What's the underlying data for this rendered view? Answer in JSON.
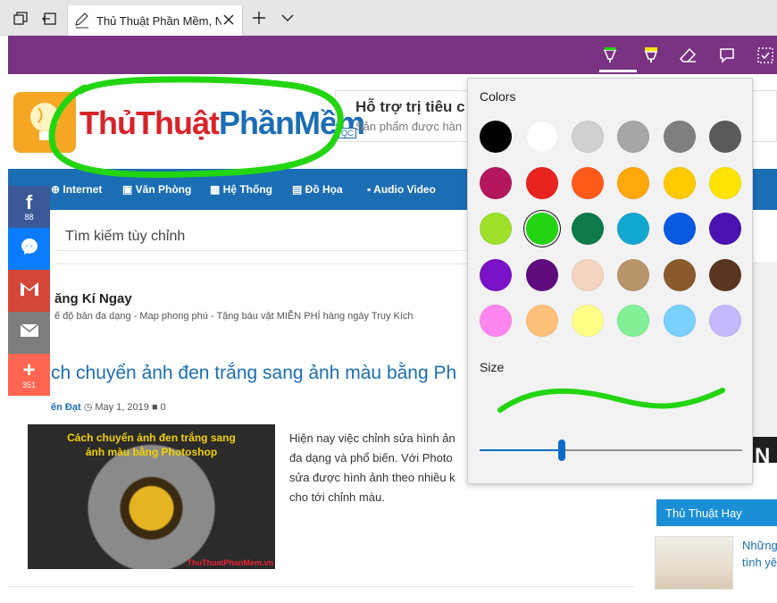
{
  "browser": {
    "tab_title": "Thủ Thuật Phần Mềm, N",
    "icons": [
      "tabs-aside-icon",
      "back-tabs-icon",
      "pen-icon",
      "close-icon",
      "plus-icon",
      "chevron-down-icon"
    ]
  },
  "ink_toolbar": {
    "tools": [
      "ballpoint-pen-icon",
      "highlighter-icon",
      "eraser-icon",
      "comment-icon",
      "clip-icon"
    ],
    "active_tool": "ballpoint-pen"
  },
  "site": {
    "logo_red": "ThủThuật",
    "logo_blue": "PhầnMềm",
    "ad_title": "Hỗ trợ trị tiêu c",
    "ad_sub": "Sản phẩm được hàn",
    "ad_badge": "QC",
    "nav": [
      "Internet",
      "Văn Phòng",
      "Hệ Thống",
      "Đồ Họa",
      "Audio Video"
    ],
    "search_text": "Tìm kiếm tùy chỉnh",
    "promo_title": "ăng Kí Ngay",
    "promo_sub": "ế độ bản đa dạng - Map phong phú - Tặng báu vật MIỄN PHÍ hàng ngày Truy Kích",
    "article_title": "ch chuyển ảnh đen trắng sang ảnh màu bằng Ph",
    "meta_author": "ến Đạt",
    "meta_date": "May 1, 2019",
    "meta_comments": "0",
    "thumb_caption_1": "Cách chuyển ảnh đen trắng sang",
    "thumb_caption_2": "ảnh màu bằng Photoshop",
    "thumb_watermark": "ThuThuatPhanMem.vn",
    "excerpt": [
      "Hiện nay việc chỉnh sửa hình ản",
      "đa dạng và phổ biến. Với Photo",
      "sửa được hình ảnh theo nhiều k",
      "cho tới chỉnh màu."
    ],
    "sidebar_letter": "N",
    "sidebar_heading": "Thủ Thuật Hay",
    "sidebar_link_1": "Những",
    "sidebar_link_2": "tình yê"
  },
  "share": {
    "facebook_count": "88",
    "total_count": "351"
  },
  "ink_panel": {
    "colors_label": "Colors",
    "size_label": "Size",
    "selected_color": "#22d510",
    "size_value_fraction": 0.31,
    "swatches": [
      "#000000",
      "#ffffff",
      "#d0d0d0",
      "#a6a6a6",
      "#7f7f7f",
      "#5a5a5a",
      "#b5175f",
      "#e8231f",
      "#ff5a1a",
      "#ffa70b",
      "#ffcb00",
      "#ffe303",
      "#9fe02a",
      "#22d510",
      "#0f7a4a",
      "#12a7cf",
      "#0a5ae0",
      "#4a12b0",
      "#7a12c8",
      "#5e0c7e",
      "#f4d4c0",
      "#b8946a",
      "#8a5a2c",
      "#5a3622",
      "#ff86ee",
      "#ffc07a",
      "#ffff88",
      "#82f096",
      "#7ad0ff",
      "#c6b8ff"
    ]
  },
  "colors": {
    "ink_bar": "#7a3382",
    "nav": "#1b6eb4",
    "ink_stroke": "#22d510"
  }
}
